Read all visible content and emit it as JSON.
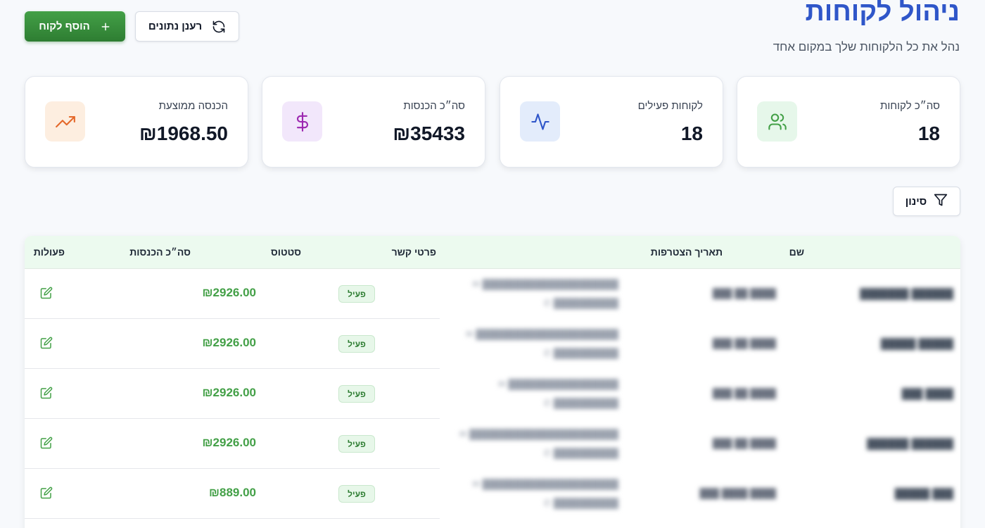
{
  "header": {
    "title": "ניהול לקוחות",
    "subtitle": "נהל את כל הלקוחות שלך במקום אחד"
  },
  "actions": {
    "add_label": "הוסף לקוח",
    "refresh_label": "רענן נתונים"
  },
  "stats": [
    {
      "label": "סה״כ לקוחות",
      "value": "18",
      "icon": "users-icon",
      "icon_bg": "#e6f7ea",
      "icon_color": "#43a047"
    },
    {
      "label": "לקוחות פעילים",
      "value": "18",
      "icon": "activity-icon",
      "icon_bg": "#e3ecfb",
      "icon_color": "#2f56c9"
    },
    {
      "label": "סה״כ הכנסות",
      "value": "₪35433",
      "icon": "dollar-icon",
      "icon_bg": "#f2e7fb",
      "icon_color": "#9c27b0"
    },
    {
      "label": "הכנסה ממוצעת",
      "value": "₪1968.50",
      "icon": "trending-up-icon",
      "icon_bg": "#fdeee0",
      "icon_color": "#e4682a"
    }
  ],
  "filter": {
    "label": "סינון"
  },
  "table": {
    "headers": {
      "name": "שם",
      "join_date": "תאריך הצטרפות",
      "contact": "פרטי קשר",
      "status": "סטטוס",
      "revenue": "סה״כ הכנסות",
      "actions": "פעולות"
    },
    "rows": [
      {
        "name": "",
        "date": "",
        "email": "",
        "phone": "",
        "status": "פעיל",
        "revenue": "₪2926.00"
      },
      {
        "name": "",
        "date": "",
        "email": "",
        "phone": "",
        "status": "פעיל",
        "revenue": "₪2926.00"
      },
      {
        "name": "",
        "date": "",
        "email": "",
        "phone": "",
        "status": "פעיל",
        "revenue": "₪2926.00"
      },
      {
        "name": "",
        "date": "",
        "email": "",
        "phone": "",
        "status": "פעיל",
        "revenue": "₪2926.00"
      },
      {
        "name": "",
        "date": "",
        "email": "",
        "phone": "",
        "status": "פעיל",
        "revenue": "₪889.00"
      }
    ]
  },
  "colors": {
    "title": "#2f56c9",
    "primary_green": "#43a047",
    "table_header_bg": "#ecfaef"
  }
}
